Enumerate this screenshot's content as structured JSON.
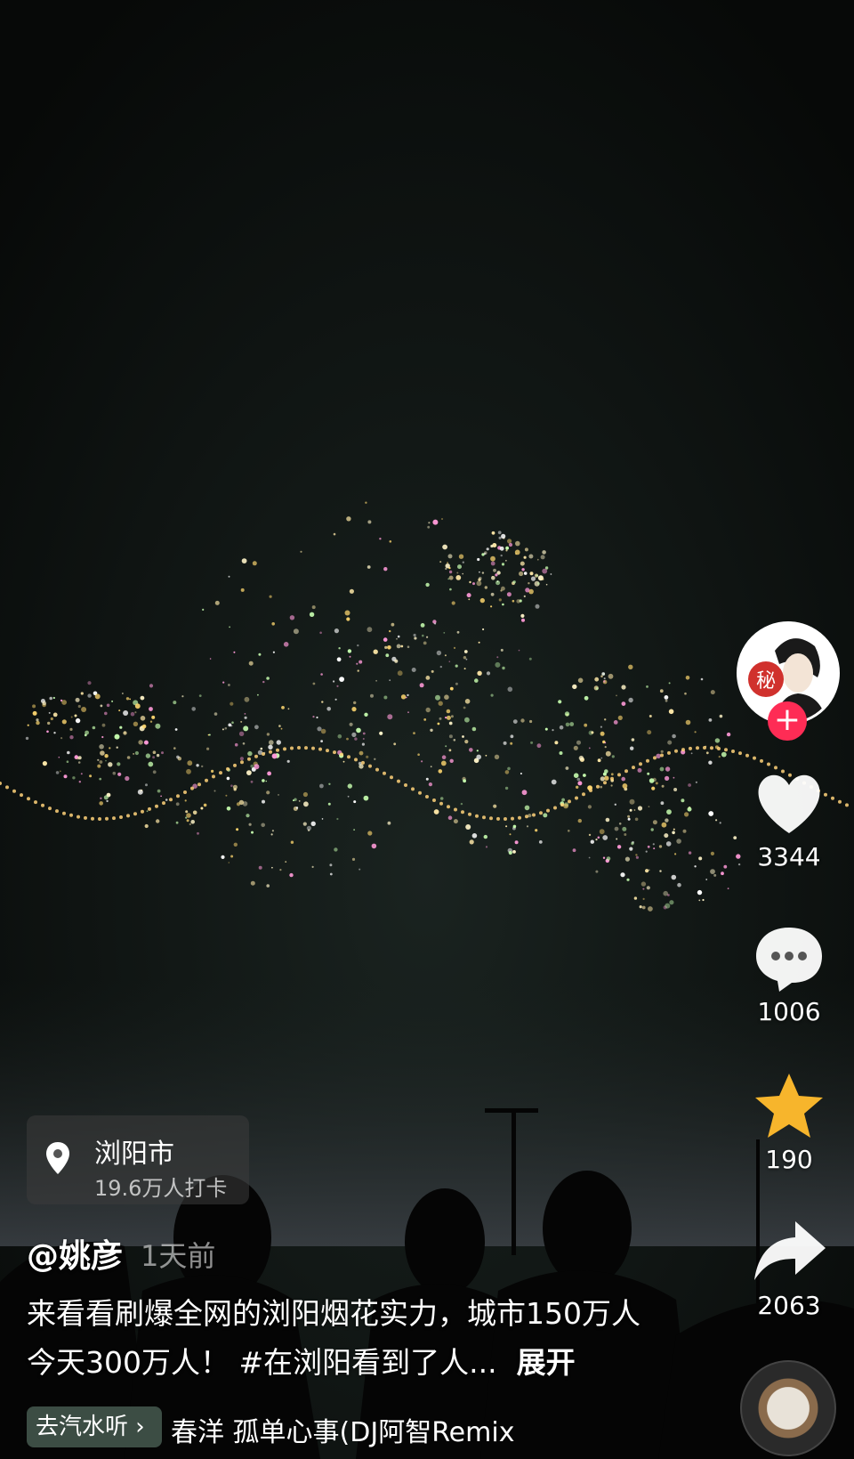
{
  "location": {
    "name": "浏阳市",
    "checkins": "19.6万人打卡"
  },
  "post": {
    "author": "@姚彦",
    "time": "1天前",
    "caption": "来看看刷爆全网的浏阳烟花实力，城市150万人今天300万人！ #在浏阳看到了人...",
    "expand": "展开"
  },
  "music": {
    "button": "去汽水听",
    "track": "春洋      孤单心事(DJ阿智Remix"
  },
  "actions": {
    "avatar_badge": "秘",
    "likes": "3344",
    "comments": "1006",
    "favorites": "190",
    "shares": "2063"
  },
  "colors": {
    "accent": "#fe2c55",
    "star": "#f7b52c"
  },
  "icons": [
    "location-pin-icon",
    "heart-icon",
    "comment-icon",
    "star-icon",
    "share-icon",
    "plus-icon",
    "music-disc-icon"
  ]
}
